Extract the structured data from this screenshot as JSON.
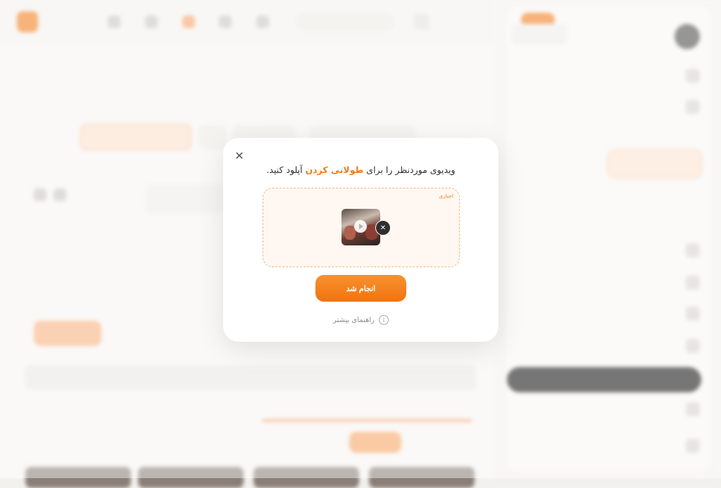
{
  "modal": {
    "prompt_before": "ویدیوی موردنظر را برای",
    "prompt_highlight": "طولانی کردن",
    "prompt_after": "آپلود کنید.",
    "dropzone_label": "اجباری",
    "done_button": "انجام شد",
    "help_link": "راهنمای بیشتر",
    "close_symbol": "✕",
    "remove_symbol": "✕",
    "info_symbol": "i",
    "accent_color": "#f07c1a"
  }
}
